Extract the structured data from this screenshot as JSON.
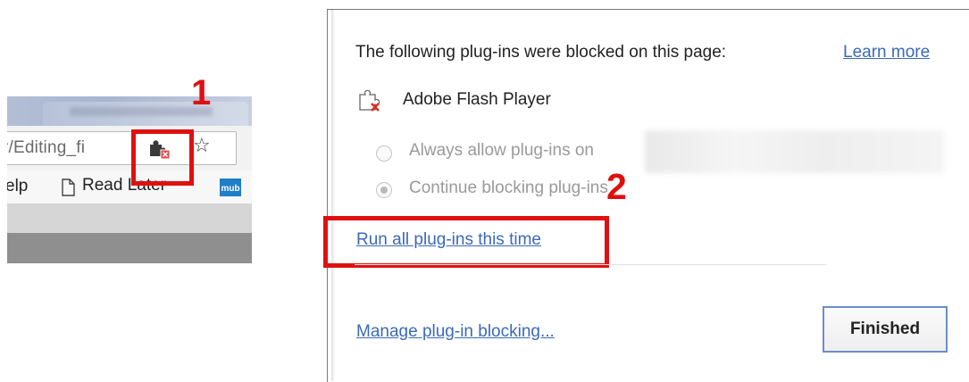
{
  "annotations": {
    "step_1": "1",
    "step_2": "2",
    "highlight_color": "#e01010"
  },
  "browser": {
    "url_fragment": "r/Editing_fi",
    "extension_icon": "puzzle-blocked-icon",
    "star_icon": "star-icon",
    "bookmarks": {
      "help_fragment": "elp",
      "read_later": "Read Later",
      "doc_icon": "document-icon",
      "mub_icon": "mub"
    }
  },
  "bubble": {
    "header": "The following plug-ins were blocked on this page:",
    "learn_more": "Learn more",
    "plugin_name": "Adobe Flash Player",
    "plugin_icon": "blocked-plugin-icon",
    "options": [
      {
        "label": "Always allow plug-ins on",
        "selected": false,
        "enabled": false
      },
      {
        "label": "Continue blocking plug-ins",
        "selected": true,
        "enabled": false
      }
    ],
    "run_all": "Run all plug-ins this time",
    "manage": "Manage plug-in blocking...",
    "finished": "Finished",
    "link_color": "#3b6ab7"
  }
}
